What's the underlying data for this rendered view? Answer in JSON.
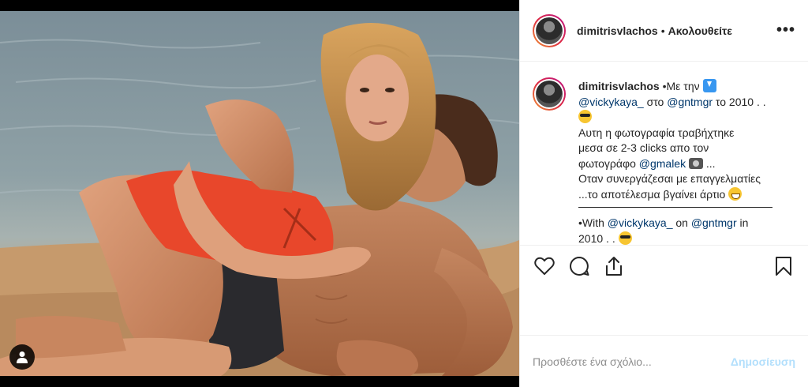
{
  "post": {
    "author": {
      "username": "dimitrisvlachos",
      "follow_status": "Ακολουθείτε"
    },
    "header_separator": "•",
    "caption": {
      "username": "dimitrisvlachos",
      "line1": "•Με την",
      "mention1": "@vickykaya_",
      "text1": "στο",
      "mention2": "@gntmgr",
      "text2": "το 2010 . .",
      "line3": "Αυτη η φωτογραφία τραβήχτηκε",
      "line4": "μεσα σε 2-3 clicks απο τον",
      "line5": "φωτογράφο",
      "mention3": "@gmalek",
      "line5_end": "...",
      "line6": "Οταν συνεργάζεσαι με επαγγελματίες",
      "line7": "...το αποτέλεσμα βγαίνει άρτιο",
      "en_line_start": "•With",
      "en_mention1": "@vickykaya_",
      "en_text1": "on",
      "en_mention2": "@gntmgr",
      "en_text2": "in",
      "en_line2": "2010 . ."
    },
    "icons": {
      "like": "heart-icon",
      "comment": "comment-icon",
      "share": "share-icon",
      "save": "bookmark-icon",
      "more": "more-options-icon",
      "tag": "user-tag-icon"
    },
    "add_comment": {
      "placeholder": "Προσθέστε ένα σχόλιο...",
      "post_label": "Δημοσίευση"
    },
    "more_label": "•••",
    "colors": {
      "link": "#00376b",
      "post_disabled": "#b2dffc",
      "text": "#262626",
      "muted": "#8e8e8e"
    }
  }
}
